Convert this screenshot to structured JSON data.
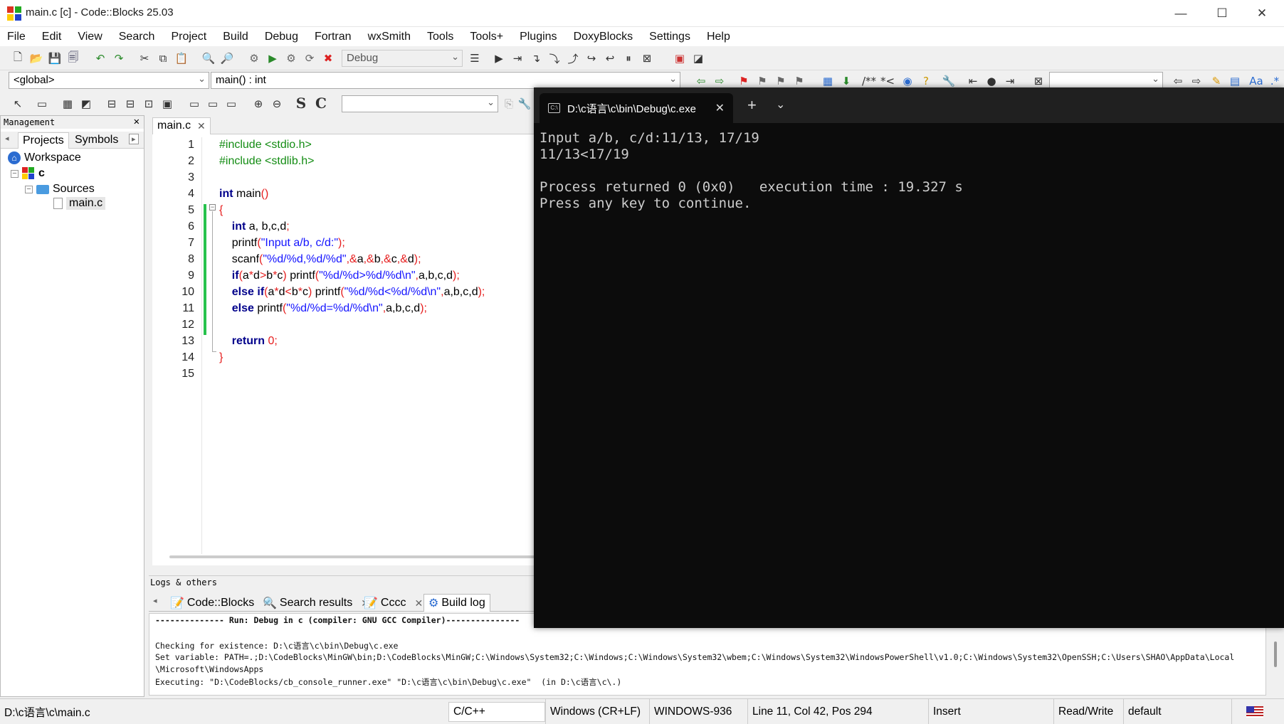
{
  "window": {
    "title": "main.c [c] - Code::Blocks 25.03"
  },
  "menu": [
    "File",
    "Edit",
    "View",
    "Search",
    "Project",
    "Build",
    "Debug",
    "Fortran",
    "wxSmith",
    "Tools",
    "Tools+",
    "Plugins",
    "DoxyBlocks",
    "Settings",
    "Help"
  ],
  "toolbar": {
    "build_target": "Debug"
  },
  "code_toolbar": {
    "scope": "<global>",
    "function": "main() : int"
  },
  "management": {
    "title": "Management",
    "tabs": [
      "Projects",
      "Symbols"
    ],
    "tree": {
      "workspace": "Workspace",
      "project": "c",
      "folder": "Sources",
      "file": "main.c"
    }
  },
  "editor": {
    "tab": "main.c",
    "line_numbers": [
      "1",
      "2",
      "3",
      "4",
      "5",
      "6",
      "7",
      "8",
      "9",
      "10",
      "11",
      "12",
      "13",
      "14",
      "15"
    ]
  },
  "logs": {
    "title": "Logs & others",
    "tabs": [
      "Code::Blocks",
      "Search results",
      "Cccc",
      "Build log"
    ],
    "lines": [
      "-------------- Run: Debug in c (compiler: GNU GCC Compiler)---------------",
      "Checking for existence: D:\\c语言\\c\\bin\\Debug\\c.exe",
      "Set variable: PATH=.;D:\\CodeBlocks\\MinGW\\bin;D:\\CodeBlocks\\MinGW;C:\\Windows\\System32;C:\\Windows;C:\\Windows\\System32\\wbem;C:\\Windows\\System32\\WindowsPowerShell\\v1.0;C:\\Windows\\System32\\OpenSSH;C:\\Users\\SHAO\\AppData\\Local",
      "\\Microsoft\\WindowsApps",
      "Executing: \"D:\\CodeBlocks/cb_console_runner.exe\" \"D:\\c语言\\c\\bin\\Debug\\c.exe\"  (in D:\\c语言\\c\\.)"
    ]
  },
  "status": {
    "path": "D:\\c语言\\c\\main.c",
    "language": "C/C++",
    "eol": "Windows (CR+LF)",
    "encoding": "WINDOWS-936",
    "position": "Line 11, Col 42, Pos 294",
    "mode": "Insert",
    "access": "Read/Write",
    "profile": "default"
  },
  "console": {
    "tab_title": "D:\\c语言\\c\\bin\\Debug\\c.exe",
    "output": "Input a/b, c/d:11/13, 17/19\n11/13<17/19\n\nProcess returned 0 (0x0)   execution time : 19.327 s\nPress any key to continue."
  }
}
